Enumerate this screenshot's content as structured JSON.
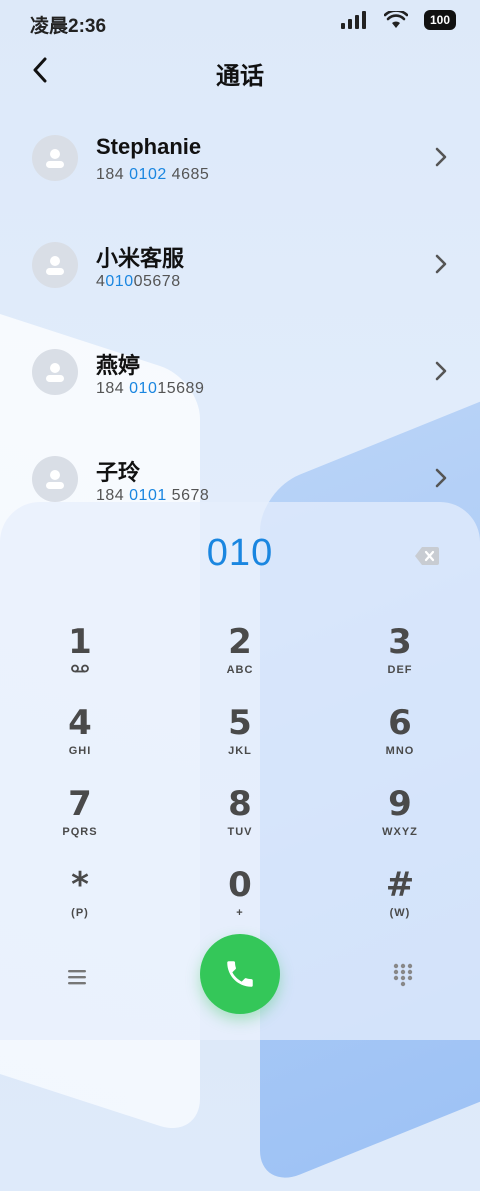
{
  "status_bar": {
    "time": "凌晨2:36",
    "battery": "100"
  },
  "header": {
    "title": "通话"
  },
  "contacts": [
    {
      "name": "Stephanie",
      "number_pre": "184 ",
      "number_match": "0102",
      "number_post": " 4685"
    },
    {
      "name": "小米客服",
      "number_pre": "4",
      "number_match": "010",
      "number_post": "05678"
    },
    {
      "name": "燕婷",
      "number_pre": "184 ",
      "number_match": "010",
      "number_post": "15689"
    },
    {
      "name": "子玲",
      "number_pre": "184 ",
      "number_match": "0101",
      "number_post": " 5678"
    }
  ],
  "dialer": {
    "input": "010",
    "keys": [
      {
        "digit": "1",
        "letters": "ꝏ"
      },
      {
        "digit": "2",
        "letters": "ABC"
      },
      {
        "digit": "3",
        "letters": "DEF"
      },
      {
        "digit": "4",
        "letters": "GHI"
      },
      {
        "digit": "5",
        "letters": "JKL"
      },
      {
        "digit": "6",
        "letters": "MNO"
      },
      {
        "digit": "7",
        "letters": "PQRS"
      },
      {
        "digit": "8",
        "letters": "TUV"
      },
      {
        "digit": "9",
        "letters": "WXYZ"
      },
      {
        "digit": "*",
        "letters": "(P)"
      },
      {
        "digit": "0",
        "letters": "+"
      },
      {
        "digit": "#",
        "letters": "(W)"
      }
    ]
  },
  "icons": {
    "back": "chevron-left-icon",
    "row_arrow": "chevron-right-icon",
    "backspace": "backspace-icon",
    "call": "phone-icon",
    "menu": "menu-icon",
    "dialpad": "dialpad-icon"
  },
  "colors": {
    "accent": "#1a86e0",
    "call_green": "#34c759"
  }
}
